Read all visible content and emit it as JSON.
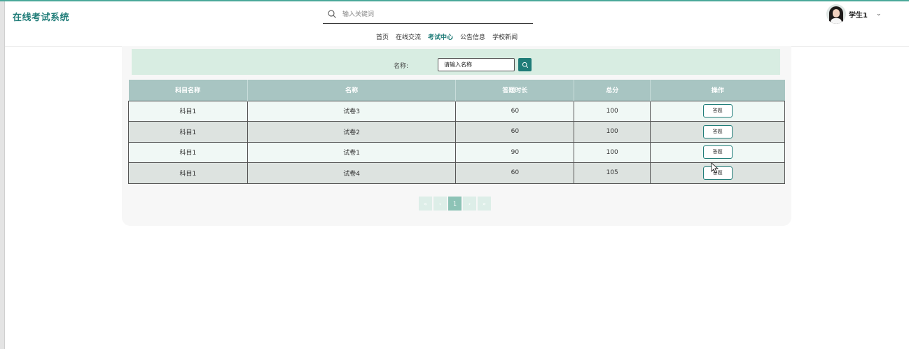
{
  "header": {
    "brand": "在线考试系统",
    "search_placeholder": "输入关键词",
    "nav": [
      {
        "label": "首页",
        "active": false
      },
      {
        "label": "在线交流",
        "active": false
      },
      {
        "label": "考试中心",
        "active": true
      },
      {
        "label": "公告信息",
        "active": false
      },
      {
        "label": "学校新闻",
        "active": false
      }
    ],
    "user": {
      "name": "学生1",
      "caret": "⌄"
    }
  },
  "filter": {
    "label": "名称:",
    "placeholder": "请输入名称"
  },
  "table": {
    "columns": [
      "科目名称",
      "名称",
      "答题时长",
      "总分",
      "操作"
    ],
    "rows": [
      {
        "subject": "科目1",
        "name": "试卷3",
        "duration": "60",
        "score": "100",
        "action": "答题"
      },
      {
        "subject": "科目1",
        "name": "试卷2",
        "duration": "60",
        "score": "100",
        "action": "答题"
      },
      {
        "subject": "科目1",
        "name": "试卷1",
        "duration": "90",
        "score": "100",
        "action": "答题"
      },
      {
        "subject": "科目1",
        "name": "试卷4",
        "duration": "60",
        "score": "105",
        "action": "答题"
      }
    ]
  },
  "pagination": {
    "first": "«",
    "prev": "‹",
    "current": "1",
    "next": "›",
    "last": "»"
  },
  "colors": {
    "accent": "#1f7c78",
    "header_row": "#a8c5c2",
    "filter_bg": "#d8ede2"
  }
}
